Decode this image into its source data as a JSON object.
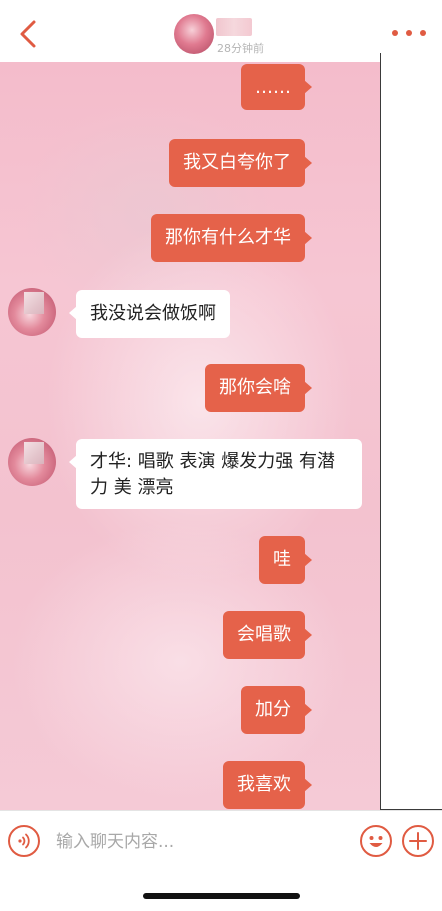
{
  "header": {
    "status_text": "28分钟前",
    "accent_color": "#e05b42"
  },
  "messages": [
    {
      "side": "right",
      "text": "……"
    },
    {
      "side": "right",
      "text": "我又白夸你了"
    },
    {
      "side": "right",
      "text": "那你有什么才华"
    },
    {
      "side": "left",
      "text": "我没说会做饭啊"
    },
    {
      "side": "right",
      "text": "那你会啥"
    },
    {
      "side": "left",
      "text_line1": "才华: 唱歌  表演  爆发力强 有潜",
      "text_line2": "力  美 漂亮"
    },
    {
      "side": "right",
      "text": "哇"
    },
    {
      "side": "right",
      "text": "会唱歌"
    },
    {
      "side": "right",
      "text": "加分"
    },
    {
      "side": "right",
      "text": "我喜欢"
    }
  ],
  "composer": {
    "placeholder": "输入聊天内容...",
    "value": ""
  },
  "colors": {
    "bubble_self": "#e5624a",
    "bubble_other": "#ffffff",
    "background_pink": "#f4bccb"
  }
}
